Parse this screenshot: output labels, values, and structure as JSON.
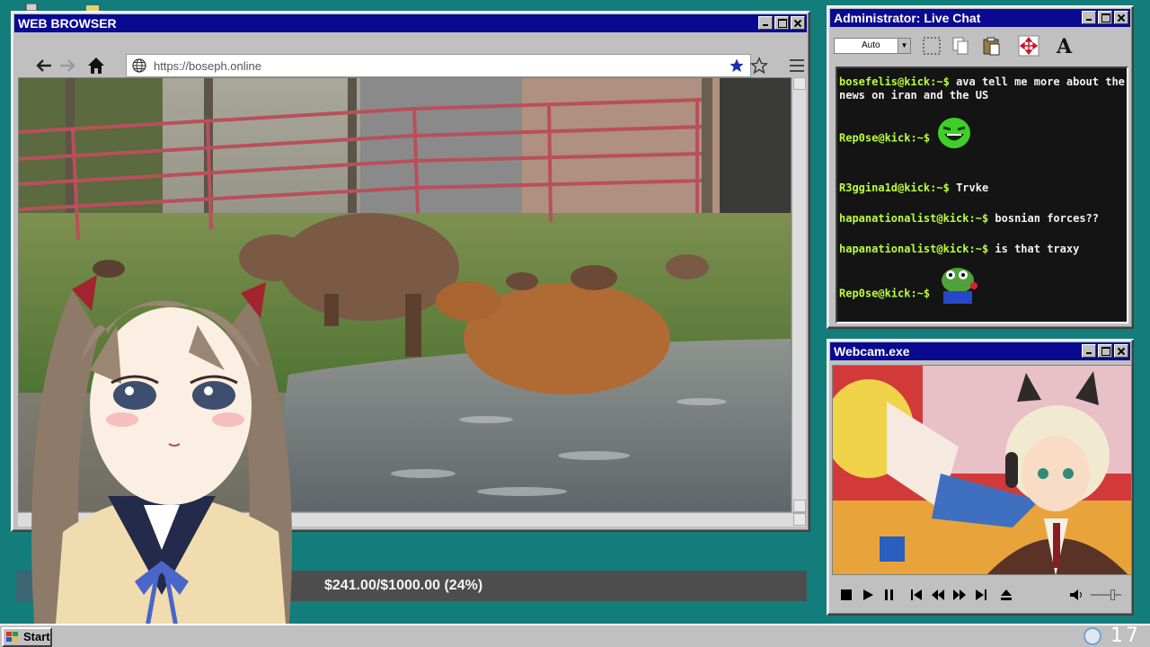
{
  "browser": {
    "title": "WEB BROWSER",
    "url": "https://boseph.online"
  },
  "chat_window": {
    "title": "Administrator: Live Chat",
    "zoom_value": "Auto",
    "messages": [
      {
        "user": "bosefelis@kick:~$",
        "text": "ava tell me more about the news on iran and the US"
      },
      {
        "user": "Rep0se@kick:~$",
        "text": "",
        "emote": "laughing-face-emote"
      },
      {
        "user": "R3ggina1d@kick:~$",
        "text": "Trvke"
      },
      {
        "user": "hapanationalist@kick:~$",
        "text": "bosnian forces??"
      },
      {
        "user": "hapanationalist@kick:~$",
        "text": "is that traxy"
      },
      {
        "user": "Rep0se@kick:~$",
        "text": "",
        "emote": "frog-emote"
      }
    ]
  },
  "webcam": {
    "title": "Webcam.exe"
  },
  "donation": {
    "label": "$241.00/$1000.00 (24%)",
    "progress": 0.241
  },
  "taskbar": {
    "start_label": "Start",
    "clock": "17"
  },
  "colors": {
    "desktop": "#137d7b",
    "titlebar": "#0a0a90",
    "chat_username": "#b9ff3c"
  }
}
